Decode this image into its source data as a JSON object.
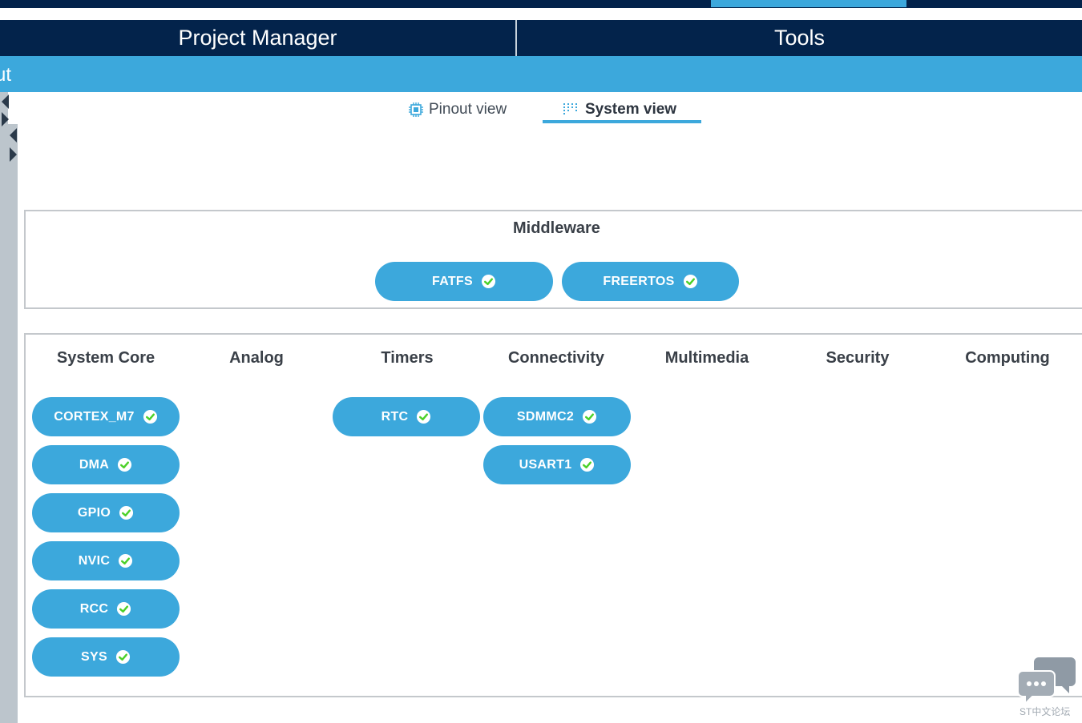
{
  "main_tabs": {
    "project_manager": "Project Manager",
    "tools": "Tools"
  },
  "subbar": {
    "text": "ut"
  },
  "view_tabs": {
    "pinout": "Pinout view",
    "system": "System view",
    "active": "system"
  },
  "middleware": {
    "title": "Middleware",
    "items": [
      "FATFS",
      "FREERTOS"
    ]
  },
  "categories": {
    "headers": [
      "System Core",
      "Analog",
      "Timers",
      "Connectivity",
      "Multimedia",
      "Security",
      "Computing"
    ],
    "system_core": [
      "CORTEX_M7",
      "DMA",
      "GPIO",
      "NVIC",
      "RCC",
      "SYS"
    ],
    "timers": [
      "RTC"
    ],
    "connectivity": [
      "SDMMC2",
      "USART1"
    ]
  },
  "watermark": {
    "text": "ST中文论坛"
  },
  "colors": {
    "navy": "#03234b",
    "accent_blue": "#3ca8dc",
    "check_green": "#4cd12a"
  }
}
